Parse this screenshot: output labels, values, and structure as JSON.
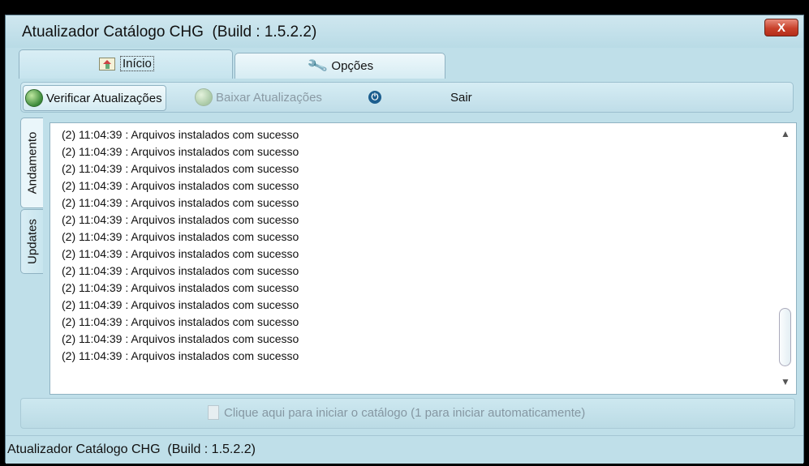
{
  "window": {
    "title": "Atualizador Catálogo CHG  (Build : 1.5.2.2)",
    "close_label": "X"
  },
  "tabs": [
    {
      "label": "Início",
      "icon": "home-icon",
      "selected": true
    },
    {
      "label": "Opções",
      "icon": "wrench-icon",
      "selected": false
    }
  ],
  "toolbar": {
    "verificar_label": "Verificar Atualizações",
    "baixar_label": "Baixar Atualizações",
    "power_glyph": "⏻",
    "sair_label": "Sair"
  },
  "side_tabs": [
    {
      "label": "Andamento",
      "selected": true
    },
    {
      "label": "Updates",
      "selected": false
    }
  ],
  "log": {
    "lines": [
      "(2) 11:04:39 : Arquivos instalados com sucesso",
      "(2) 11:04:39 : Arquivos instalados com sucesso",
      "(2) 11:04:39 : Arquivos instalados com sucesso",
      "(2) 11:04:39 : Arquivos instalados com sucesso",
      "(2) 11:04:39 : Arquivos instalados com sucesso",
      "(2) 11:04:39 : Arquivos instalados com sucesso",
      "(2) 11:04:39 : Arquivos instalados com sucesso",
      "(2) 11:04:39 : Arquivos instalados com sucesso",
      "(2) 11:04:39 : Arquivos instalados com sucesso",
      "(2) 11:04:39 : Arquivos instalados com sucesso",
      "(2) 11:04:39 : Arquivos instalados com sucesso",
      "(2) 11:04:39 : Arquivos instalados com sucesso",
      "(2) 11:04:39 : Arquivos instalados com sucesso",
      "(2) 11:04:39 : Arquivos instalados com sucesso"
    ],
    "scroll_up": "▲",
    "scroll_down": "▼"
  },
  "start_link": {
    "label": "Clique aqui para iniciar o catálogo (1 para iniciar automaticamente)"
  },
  "statusbar": {
    "text": "Atualizador Catálogo CHG  (Build : 1.5.2.2)"
  },
  "colors": {
    "window_bg": "#bfdfe9",
    "close_red": "#c8412b",
    "disabled_text": "#8597a2"
  }
}
